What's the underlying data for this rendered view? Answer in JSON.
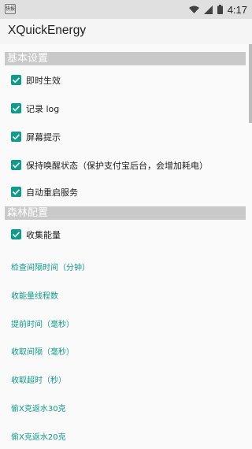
{
  "status_bar": {
    "left_badge": "快报",
    "time": "4:17"
  },
  "app_bar": {
    "title": "XQuickEnergy"
  },
  "sections": {
    "basic": {
      "title": "基本设置",
      "items": [
        {
          "label": "即时生效",
          "checked": true
        },
        {
          "label": "记录 log",
          "checked": true
        },
        {
          "label": "屏幕提示",
          "checked": true
        },
        {
          "label": "保持唤醒状态（保护支付宝后台，会增加耗电）",
          "checked": true
        },
        {
          "label": "自动重启服务",
          "checked": true
        }
      ]
    },
    "forest": {
      "title": "森林配置",
      "items": [
        {
          "label": "收集能量",
          "checked": true
        }
      ],
      "links": [
        "检查间隔时间（分钟）",
        "收能量线程数",
        "提前时间（毫秒）",
        "收取间隔（毫秒）",
        "收取超时（秒）",
        "偷X克返水30克",
        "偷X克返水20克"
      ]
    }
  },
  "colors": {
    "accent": "#0d9b8a",
    "section_header_bg": "#c9c9c9",
    "status_bar_bg": "#e0e0e0"
  }
}
